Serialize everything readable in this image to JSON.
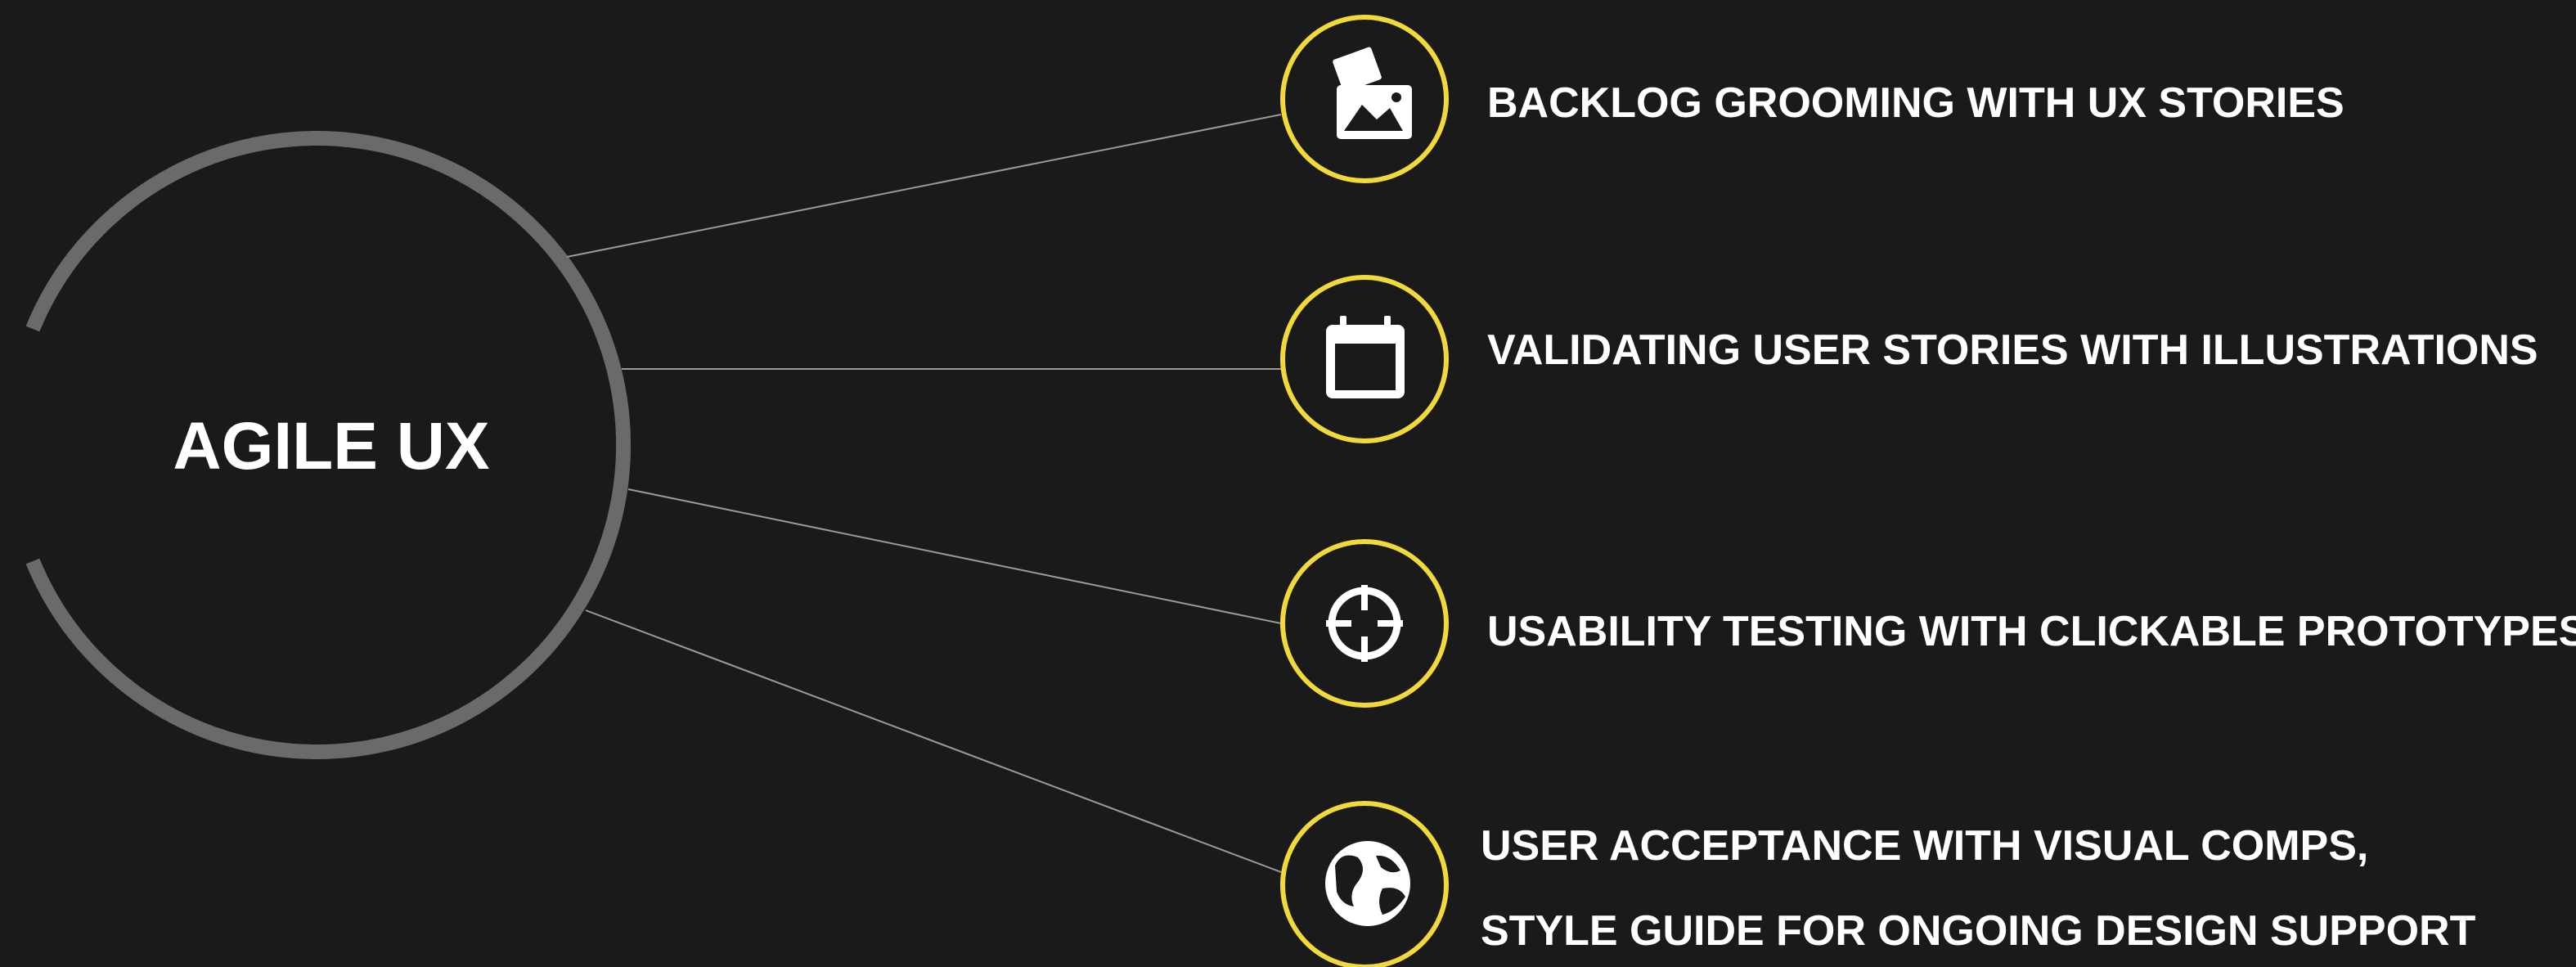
{
  "title": "AGILE UX",
  "colors": {
    "background": "#1a1a1a",
    "ring": "#6a6a6a",
    "accent": "#f2d93b",
    "connector": "#9a9a9a",
    "text": "#ffffff"
  },
  "items": [
    {
      "icon": "images-icon",
      "lines": [
        "BACKLOG GROOMING WITH UX STORIES"
      ]
    },
    {
      "icon": "calendar-icon",
      "lines": [
        "VALIDATING USER STORIES WITH ILLUSTRATIONS"
      ]
    },
    {
      "icon": "crosshair-icon",
      "lines": [
        "USABILITY TESTING WITH CLICKABLE PROTOTYPES"
      ]
    },
    {
      "icon": "globe-icon",
      "lines": [
        "USER ACCEPTANCE WITH VISUAL COMPS,",
        "STYLE GUIDE FOR ONGOING DESIGN SUPPORT"
      ]
    }
  ]
}
